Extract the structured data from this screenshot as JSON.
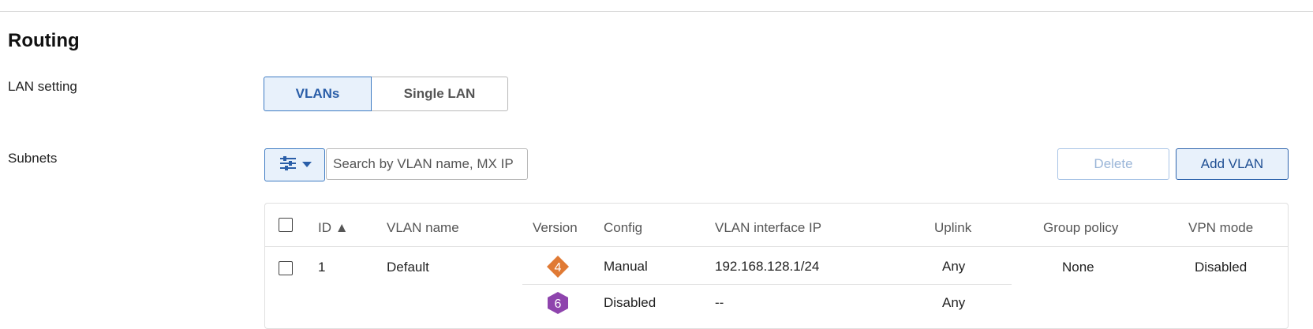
{
  "page": {
    "title": "Routing"
  },
  "lan_setting": {
    "label": "LAN setting",
    "options": [
      "VLANs",
      "Single LAN"
    ],
    "selected": "VLANs"
  },
  "subnets": {
    "label": "Subnets",
    "search_placeholder": "Search by VLAN name, MX IP",
    "delete_label": "Delete",
    "add_label": "Add VLAN",
    "filter_icon": "sliders-icon"
  },
  "table": {
    "columns": [
      "ID ▲",
      "VLAN name",
      "Version",
      "Config",
      "VLAN interface IP",
      "Uplink",
      "Group policy",
      "VPN mode"
    ],
    "rows": [
      {
        "id": "1",
        "name": "Default",
        "group_policy": "None",
        "vpn_mode": "Disabled",
        "versions": [
          {
            "version": "4",
            "badge_color": "#e07a34",
            "config": "Manual",
            "ip": "192.168.128.1/24",
            "uplink": "Any"
          },
          {
            "version": "6",
            "badge_color": "#8e44ad",
            "config": "Disabled",
            "ip": "--",
            "uplink": "Any"
          }
        ]
      }
    ]
  },
  "colors": {
    "accent": "#3f7cc3",
    "accent_bg": "#e8f1fb",
    "ipv4_badge": "#e07a34",
    "ipv6_badge": "#8e44ad"
  }
}
